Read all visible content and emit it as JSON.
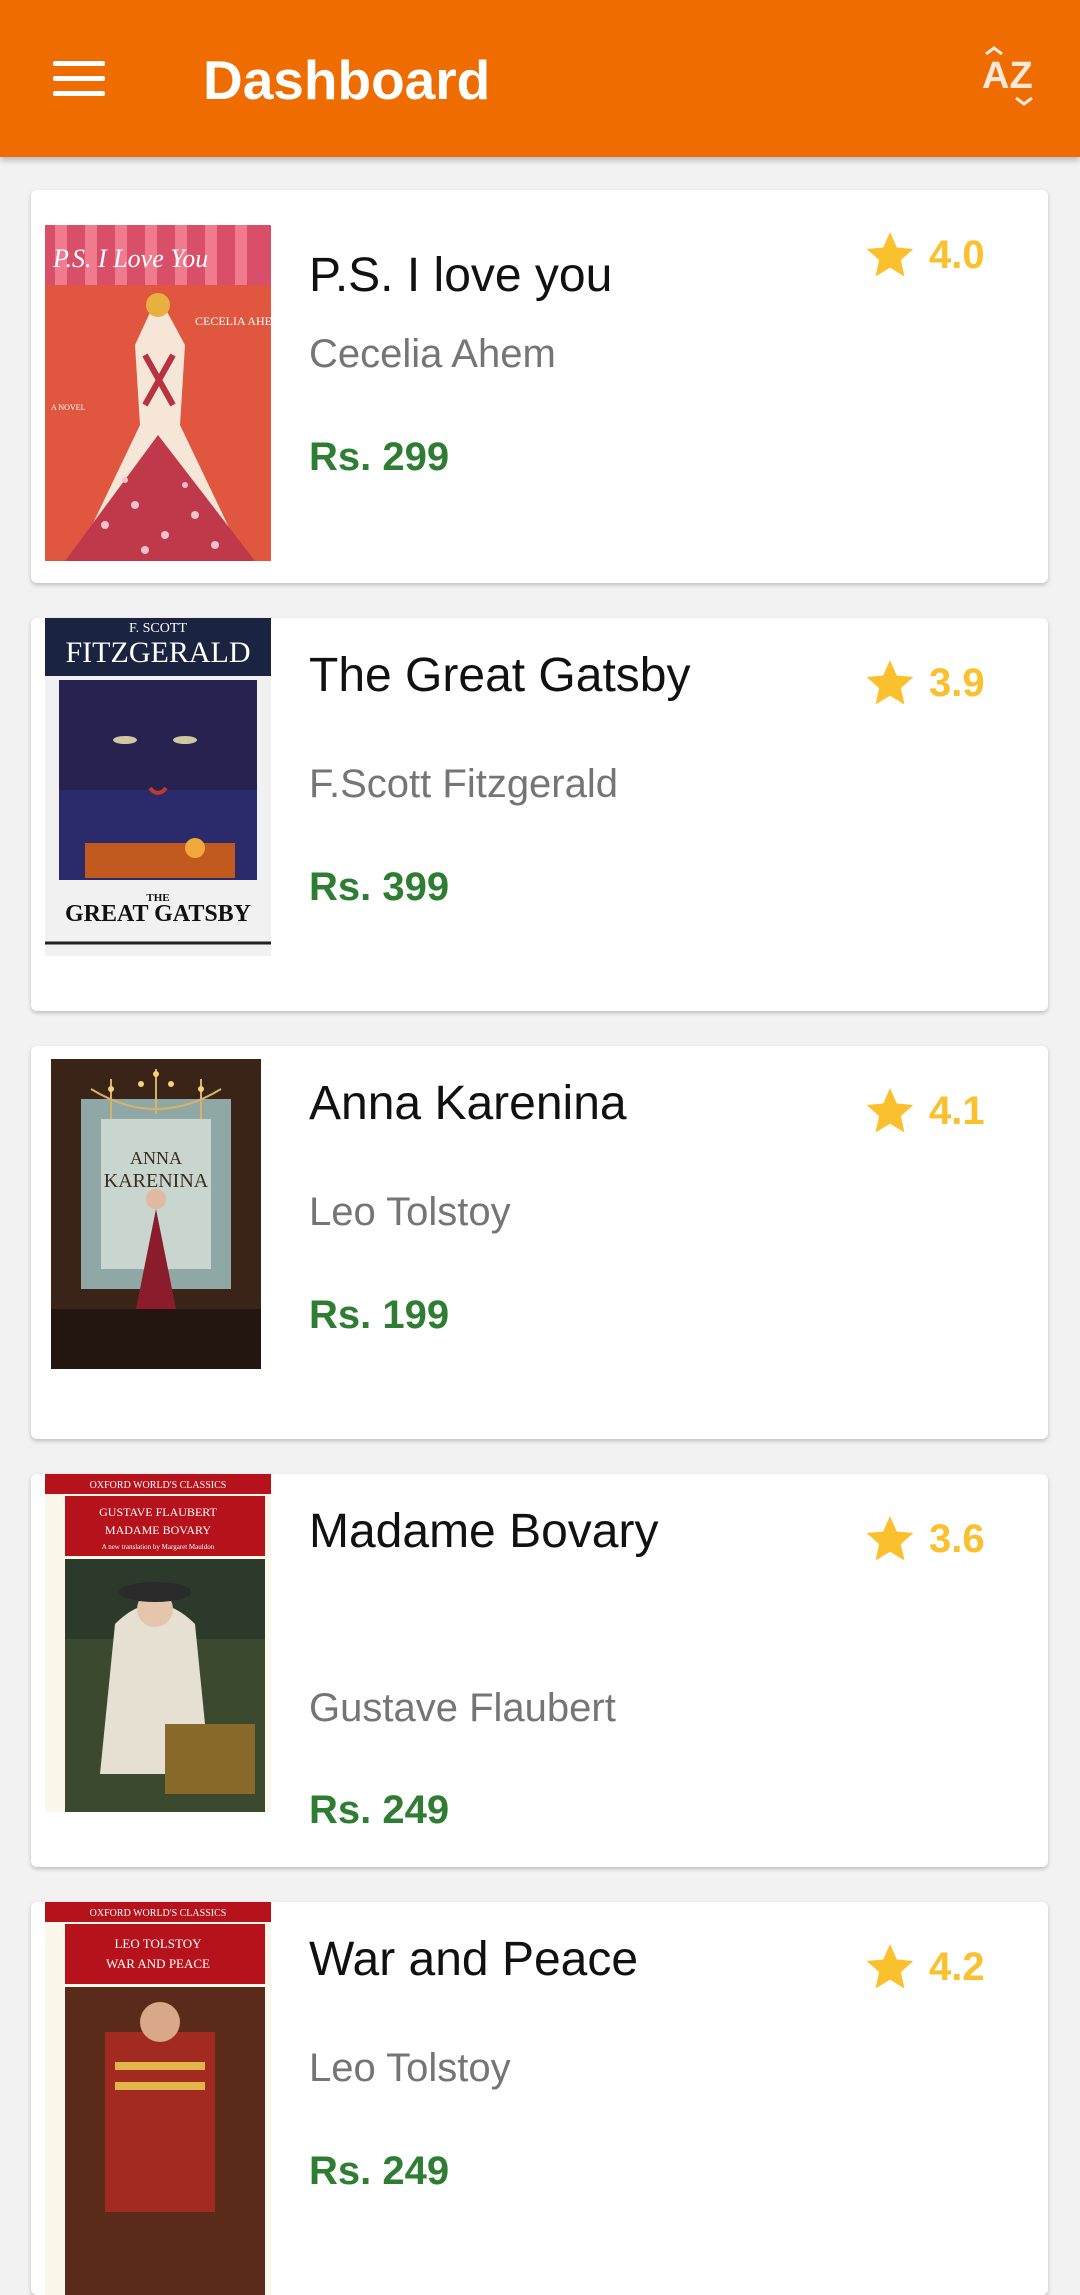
{
  "appbar": {
    "title": "Dashboard",
    "background_color": "#ef6c00",
    "menu_icon": "hamburger-menu-icon",
    "sort_icon": "sort-alphabetical-icon",
    "sort_icon_text": "AZ"
  },
  "colors": {
    "price": "#2e7d32",
    "rating": "#fbc02d",
    "author": "#757575"
  },
  "books": [
    {
      "title": "P.S. I love you",
      "author": "Cecelia Ahem",
      "price": "Rs. 299",
      "rating": "4.0",
      "cover": {
        "top_text": "P.S. I Love You",
        "sub_text": "CECELIA AHERN",
        "side_text": "A NOVEL"
      }
    },
    {
      "title": "The Great Gatsby",
      "author": "F.Scott Fitzgerald",
      "price": "Rs. 399",
      "rating": "3.9",
      "cover": {
        "top_text": "F. SCOTT",
        "sub_text": "FITZGERALD",
        "bottom_small": "THE",
        "bottom_text": "GREAT GATSBY"
      }
    },
    {
      "title": "Anna Karenina",
      "author": "Leo Tolstoy",
      "price": "Rs. 199",
      "rating": "4.1",
      "cover": {
        "top_text": "ANNA",
        "sub_text": "KARENINA"
      }
    },
    {
      "title": "Madame Bovary",
      "author": "Gustave Flaubert",
      "price": "Rs. 249",
      "rating": "3.6",
      "cover": {
        "top_text": "OXFORD WORLD'S CLASSICS",
        "sub_text": "GUSTAVE FLAUBERT",
        "sub_text2": "MADAME BOVARY",
        "note": "A new translation by Margaret Mauldon"
      }
    },
    {
      "title": "War and Peace",
      "author": "Leo Tolstoy",
      "price": "Rs. 249",
      "rating": "4.2",
      "cover": {
        "top_text": "OXFORD WORLD'S CLASSICS",
        "sub_text": "LEO TOLSTOY",
        "sub_text2": "WAR AND PEACE"
      }
    }
  ]
}
